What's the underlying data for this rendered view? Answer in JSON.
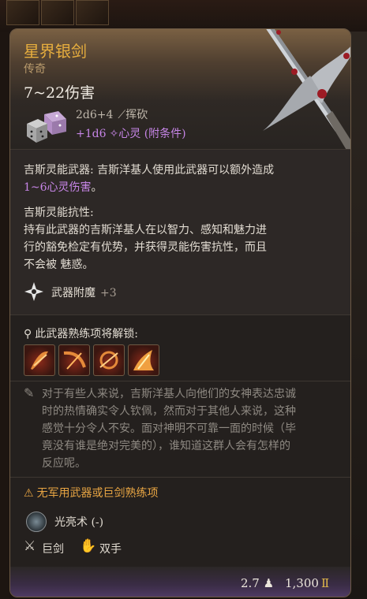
{
  "item": {
    "name": "星界银剑",
    "rarity": "传奇",
    "damage_range": "7~22伤害",
    "damage_lines": [
      {
        "formula": "2d6+4",
        "icon": "slash-icon",
        "type": "挥砍"
      },
      {
        "formula": "+1d6",
        "icon": "psychic-icon",
        "type": "心灵 (附条件)"
      }
    ]
  },
  "passives": {
    "weapon_name": "吉斯灵能武器:",
    "weapon_text": " 吉斯洋基人使用此武器可以额外造成",
    "weapon_highlight": "1~6心灵伤害",
    "weapon_end": "。",
    "resist_name": "吉斯灵能抗性:",
    "resist_lines": [
      "持有此武器的吉斯洋基人在以智力、感知和魅力进",
      "行的豁免检定有优势，并获得灵能伤害抗性，而且",
      "不会被 魅惑。"
    ]
  },
  "enchantment": {
    "label": "武器附魔",
    "value": "+3"
  },
  "proficiency": {
    "title": "此武器熟练项将解锁:",
    "actions": [
      "action-icon-1",
      "action-icon-2",
      "action-icon-3",
      "action-icon-4"
    ]
  },
  "flavor_lines": [
    "对于有些人来说，吉斯洋基人向他们的女神表达忠诚",
    "时的热情确实令人钦佩，然而对于其他人来说，这种",
    "感觉十分令人不安。面对神明不可靠一面的时候（毕",
    "竟没有谁是绝对完美的），谁知道这群人会有怎样的",
    "反应呢。"
  ],
  "warning": "无军用武器或巨剑熟练项",
  "spell": "光亮术 (-)",
  "properties": [
    {
      "icon": "greatsword-icon",
      "label": "巨剑"
    },
    {
      "icon": "two-handed-icon",
      "label": "双手"
    }
  ],
  "footer": {
    "weight": "2.7",
    "price": "1,300"
  },
  "colors": {
    "title": "#e7ae3e",
    "psychic": "#c685e6",
    "warning": "#e8a543",
    "gold": "#e1b84a"
  }
}
